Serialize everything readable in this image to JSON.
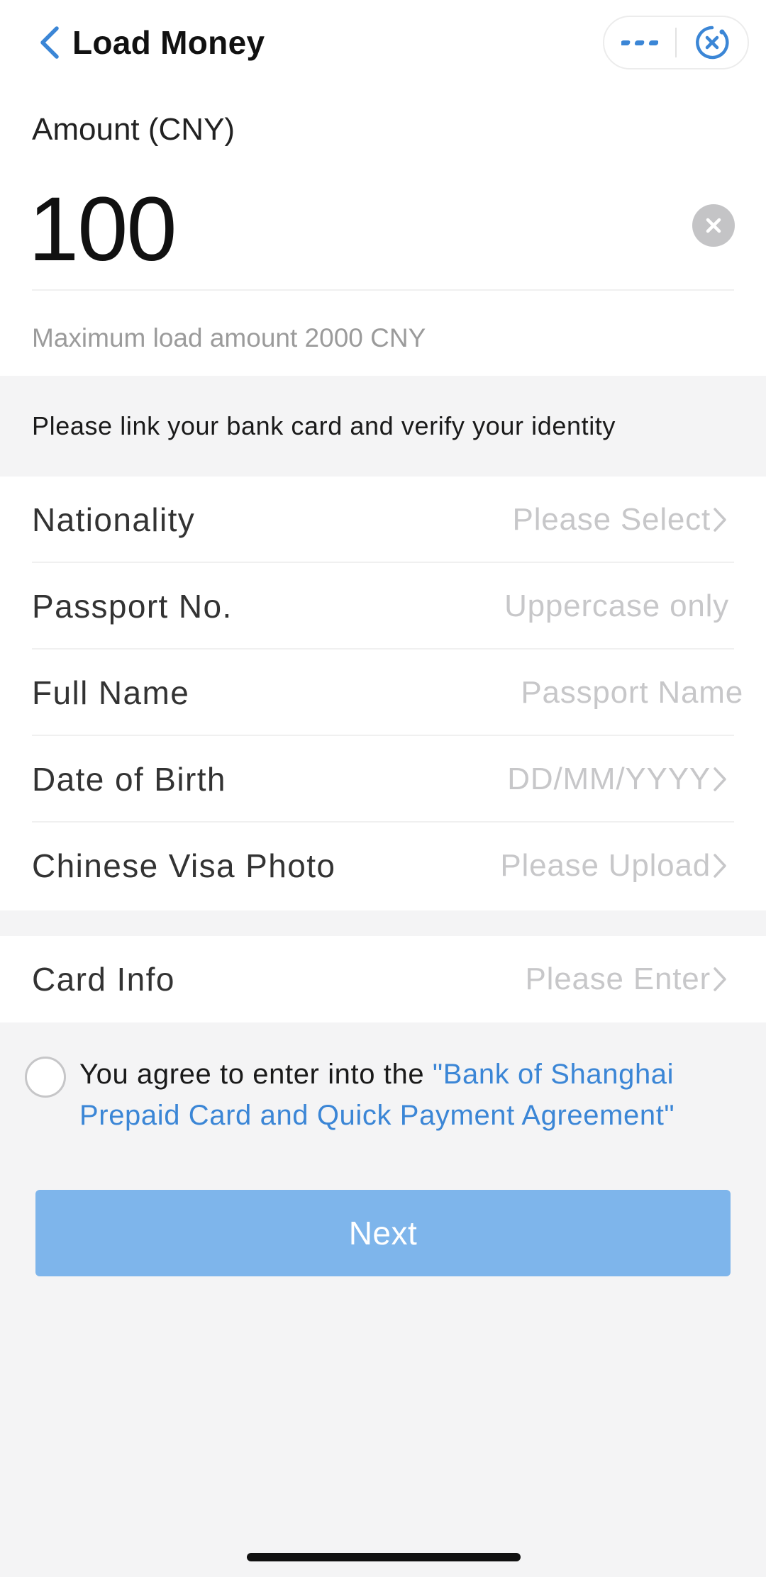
{
  "header": {
    "title": "Load Money",
    "icons": {
      "back": "chevron-left-icon",
      "more": "more-dots-icon",
      "close": "close-target-icon"
    }
  },
  "amount": {
    "label": "Amount (CNY)",
    "value": "100",
    "max_note": "Maximum load amount 2000 CNY"
  },
  "notice": "Please link your bank card and verify your identity",
  "identity_form": {
    "nationality": {
      "label": "Nationality",
      "placeholder": "Please Select"
    },
    "passport": {
      "label": "Passport No.",
      "placeholder": "Uppercase only"
    },
    "full_name": {
      "label": "Full Name",
      "placeholder": "Passport Name"
    },
    "dob": {
      "label": "Date of Birth",
      "placeholder": "DD/MM/YYYY"
    },
    "visa_photo": {
      "label": "Chinese Visa Photo",
      "placeholder": "Please Upload"
    }
  },
  "card_form": {
    "card_info": {
      "label": "Card Info",
      "placeholder": "Please Enter"
    }
  },
  "agreement": {
    "prefix": "You agree to enter into the ",
    "link": "\"Bank of Shanghai Prepaid Card and Quick Payment Agreement\""
  },
  "next_label": "Next",
  "colors": {
    "accent": "#3b86d6",
    "button_disabled": "#7eb5eb",
    "placeholder": "#c7c7c9",
    "background": "#f4f4f5"
  }
}
